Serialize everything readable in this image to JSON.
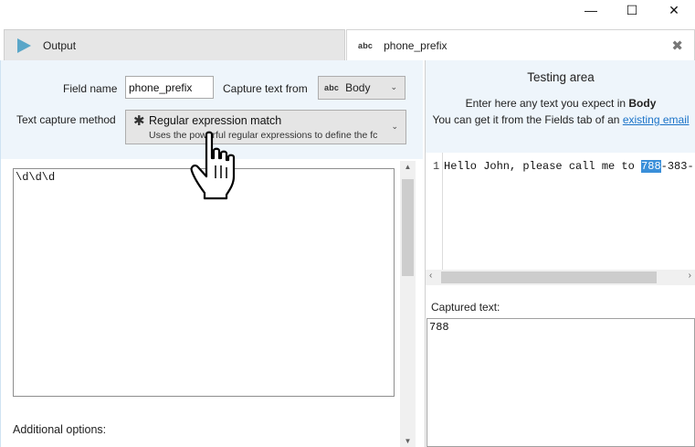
{
  "window": {
    "minimize_glyph": "—",
    "maximize_glyph": "☐",
    "close_glyph": "✕"
  },
  "tabs": [
    {
      "label": "Output",
      "icon": "play-icon"
    },
    {
      "label": "phone_prefix",
      "icon": "abc-icon",
      "icon_text": "abc",
      "close_glyph": "✖"
    }
  ],
  "field_config": {
    "field_name_label": "Field name",
    "field_name_value": "phone_prefix",
    "capture_from_label": "Capture text from",
    "capture_from_value": "Body",
    "capture_from_icon_text": "abc",
    "method_label": "Text capture method",
    "method_title": "Regular expression match",
    "method_description": "Uses the powerful regular expressions to define the fc"
  },
  "regex_editor": {
    "value": "\\d\\d\\d"
  },
  "additional_options_label": "Additional options:",
  "testing_area": {
    "title": "Testing area",
    "instruction_prefix": "Enter here any text you expect in ",
    "instruction_target": "Body",
    "hint_prefix": "You can get it from the Fields tab of an ",
    "hint_link": "existing email",
    "line_number": "1",
    "sample_before": "Hello John, please call me to ",
    "sample_match": "788",
    "sample_after": "-383-",
    "captured_label": "Captured text:",
    "captured_value": "788"
  },
  "colors": {
    "accent": "#3a8fd9",
    "link": "#1a73c8",
    "panel_bg": "#eef5fb",
    "play_icon": "#5aa6c8"
  }
}
